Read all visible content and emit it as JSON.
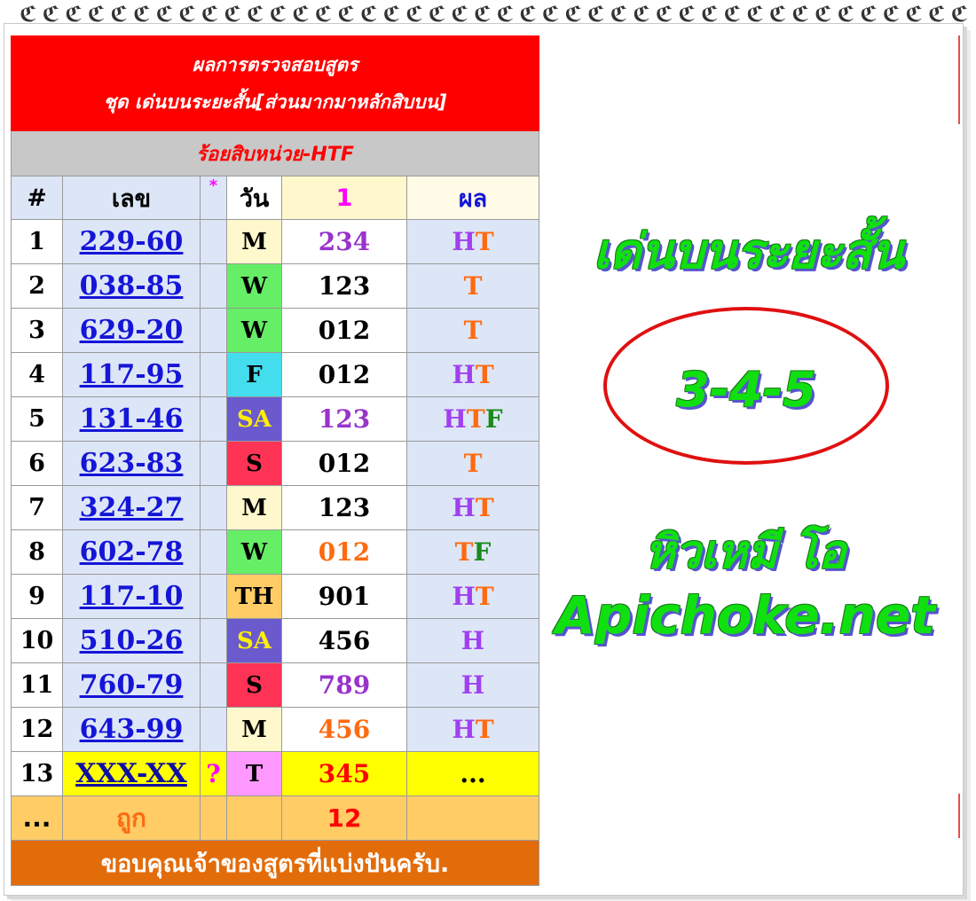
{
  "header": {
    "line1": "ผลการตรวจสอบสูตร",
    "line2": "ชุด เด่นบนระยะสั้น[ส่วนมากมาหลักสิบบน]",
    "sub": "ร้อยสิบหน่วย-HTF"
  },
  "columns": {
    "num": "#",
    "lek": "เลข",
    "star": "*",
    "day": "วัน",
    "one": "1",
    "result": "ผล"
  },
  "rows": [
    {
      "num": "1",
      "lek": "229-60",
      "star": "",
      "day": "M",
      "one": "234",
      "result": [
        {
          "t": "H",
          "c": "#a040f0"
        },
        {
          "t": "T",
          "c": "#ff6a10"
        }
      ]
    },
    {
      "num": "2",
      "lek": "038-85",
      "star": "",
      "day": "W",
      "one": "123",
      "result": [
        {
          "t": "T",
          "c": "#ff6a10"
        }
      ]
    },
    {
      "num": "3",
      "lek": "629-20",
      "star": "",
      "day": "W",
      "one": "012",
      "result": [
        {
          "t": "T",
          "c": "#ff6a10"
        }
      ]
    },
    {
      "num": "4",
      "lek": "117-95",
      "star": "",
      "day": "F",
      "one": "012",
      "result": [
        {
          "t": "H",
          "c": "#a040f0"
        },
        {
          "t": "T",
          "c": "#ff6a10"
        }
      ]
    },
    {
      "num": "5",
      "lek": "131-46",
      "star": "",
      "day": "SA",
      "one": "123",
      "result": [
        {
          "t": "H",
          "c": "#a040f0"
        },
        {
          "t": "T",
          "c": "#ff6a10"
        },
        {
          "t": "F",
          "c": "#1a8a1a"
        }
      ]
    },
    {
      "num": "6",
      "lek": "623-83",
      "star": "",
      "day": "S",
      "one": "012",
      "result": [
        {
          "t": "T",
          "c": "#ff6a10"
        }
      ]
    },
    {
      "num": "7",
      "lek": "324-27",
      "star": "",
      "day": "M",
      "one": "123",
      "result": [
        {
          "t": "H",
          "c": "#a040f0"
        },
        {
          "t": "T",
          "c": "#ff6a10"
        }
      ]
    },
    {
      "num": "8",
      "lek": "602-78",
      "star": "",
      "day": "W",
      "one": "012",
      "result": [
        {
          "t": "T",
          "c": "#ff6a10"
        },
        {
          "t": "F",
          "c": "#1a8a1a"
        }
      ]
    },
    {
      "num": "9",
      "lek": "117-10",
      "star": "",
      "day": "TH",
      "one": "901",
      "result": [
        {
          "t": "H",
          "c": "#a040f0"
        },
        {
          "t": "T",
          "c": "#ff6a10"
        }
      ]
    },
    {
      "num": "10",
      "lek": "510-26",
      "star": "",
      "day": "SA",
      "one": "456",
      "result": [
        {
          "t": "H",
          "c": "#a040f0"
        }
      ]
    },
    {
      "num": "11",
      "lek": "760-79",
      "star": "",
      "day": "S",
      "one": "789",
      "result": [
        {
          "t": "H",
          "c": "#a040f0"
        }
      ]
    },
    {
      "num": "12",
      "lek": "643-99",
      "star": "",
      "day": "M",
      "one": "456",
      "result": [
        {
          "t": "H",
          "c": "#a040f0"
        },
        {
          "t": "T",
          "c": "#ff6a10"
        }
      ]
    },
    {
      "num": "13",
      "lek": "XXX-XX",
      "star": "?",
      "day": "T",
      "one": "345",
      "result": [
        {
          "t": "...",
          "c": "#000000"
        }
      ]
    }
  ],
  "day_colors": {
    "M": "#fff8cc",
    "W": "#66ee66",
    "F": "#44ddee",
    "SA": "#6a5acd",
    "S": "#ff3355",
    "TH": "#ffcc66",
    "T": "#ff99ff"
  },
  "day_text_colors": {
    "SA": "#ffee00"
  },
  "one_colors": [
    "#9933cc",
    "#000000",
    "#000000",
    "#000000",
    "#9933cc",
    "#000000",
    "#000000",
    "#ff6a10",
    "#000000",
    "#000000",
    "#9933cc",
    "#ff6a10",
    "#ff0000"
  ],
  "summary": {
    "num": "...",
    "label": "ถูก",
    "count": "12"
  },
  "footer": "ขอบคุณเจ้าของสูตรที่แบ่งปันครับ.",
  "right": {
    "title": "เด่นบนระยะสั้น",
    "formula": "3-4-5",
    "author": "หิวเหมี โอ",
    "site": "Apichoke.net"
  }
}
